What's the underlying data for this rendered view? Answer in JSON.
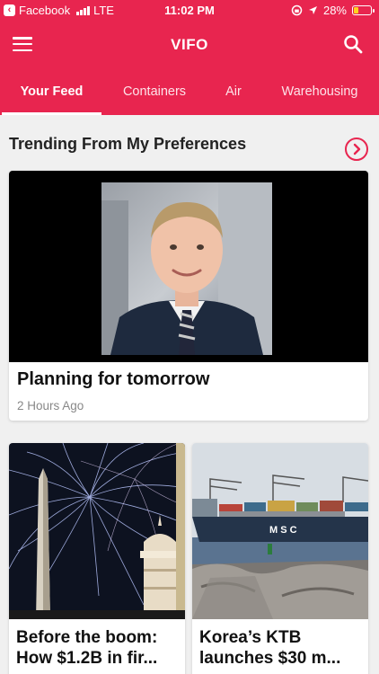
{
  "status_bar": {
    "back_app": "Facebook",
    "carrier": "LTE",
    "time": "11:02 PM",
    "battery": "28%",
    "battery_level": 0.28
  },
  "app_bar": {
    "title": "VIFO",
    "menu_icon": "hamburger-menu-icon",
    "search_icon": "search-icon"
  },
  "tabs": [
    {
      "label": "Your Feed",
      "active": true
    },
    {
      "label": "Containers",
      "active": false
    },
    {
      "label": "Air",
      "active": false
    },
    {
      "label": "Warehousing",
      "active": false
    }
  ],
  "section": {
    "title": "Trending From My Preferences",
    "arrow_icon": "chevron-right-circle-icon"
  },
  "featured": {
    "headline": "Planning for tomorrow",
    "meta": "2 Hours Ago"
  },
  "cards": [
    {
      "headline_line1": "Before the boom:",
      "headline_line2": "How $1.2B in fir..."
    },
    {
      "headline_line1": "Korea’s KTB",
      "headline_line2": "launches $30 m..."
    }
  ],
  "colors": {
    "brand": "#e8254f",
    "battery_fill": "#ffd21e"
  }
}
